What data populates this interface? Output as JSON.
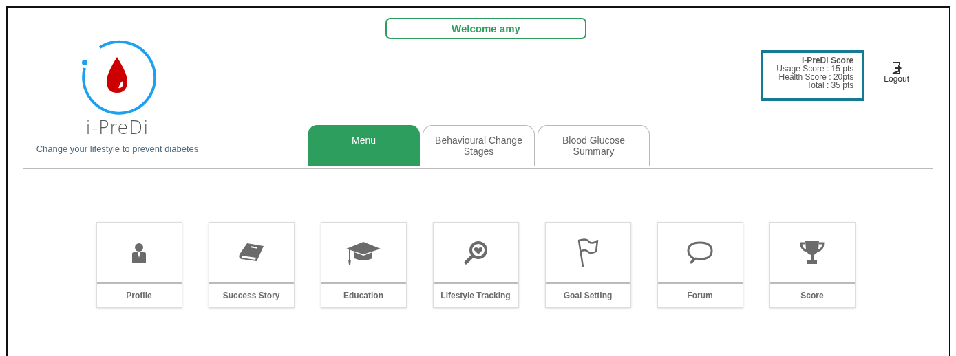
{
  "welcome": "Welcome amy",
  "logo": {
    "name": "i-PreDi",
    "tagline": "Change your lifestyle to prevent diabetes"
  },
  "score_box": {
    "title": "i-PreDi Score",
    "lines": [
      "Usage Score : 15 pts",
      "Health Score : 20pts",
      "Total : 35 pts"
    ]
  },
  "logout": "Logout",
  "tabs": [
    {
      "label": "Menu",
      "selected": true
    },
    {
      "label": "Behavioural Change Stages",
      "selected": false
    },
    {
      "label": "Blood Glucose Summary",
      "selected": false
    }
  ],
  "tiles": [
    {
      "kind": "person",
      "label": "Profile"
    },
    {
      "kind": "book",
      "label": "Success Story"
    },
    {
      "kind": "cap",
      "label": "Education"
    },
    {
      "kind": "magnifier",
      "label": "Lifestyle Tracking"
    },
    {
      "kind": "flag",
      "label": "Goal Setting"
    },
    {
      "kind": "bubble",
      "label": "Forum"
    },
    {
      "kind": "trophy",
      "label": "Score"
    }
  ]
}
